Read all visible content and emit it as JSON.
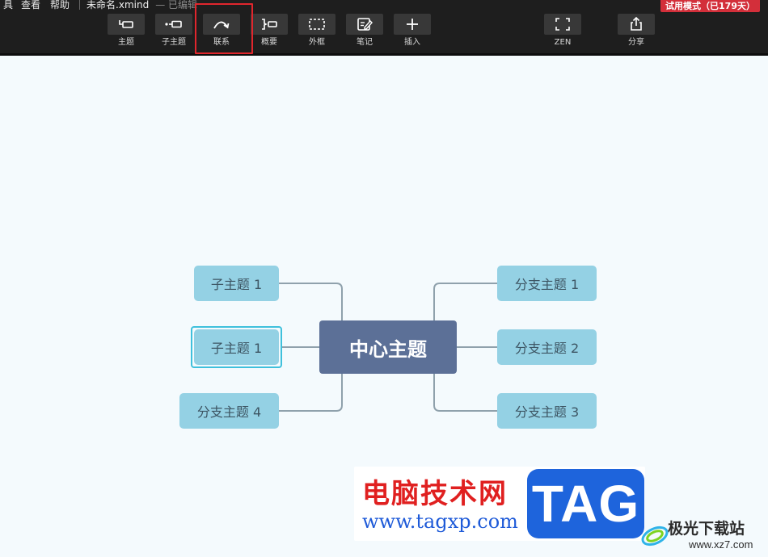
{
  "menu": {
    "items": [
      "具",
      "查看",
      "帮助"
    ],
    "file_name": "未命名.xmind",
    "file_status": "— 已编辑"
  },
  "trial_badge": "试用模式（已179天）",
  "toolbar": {
    "tools": [
      {
        "label": "主题",
        "icon": "topic-icon"
      },
      {
        "label": "子主题",
        "icon": "subtopic-icon"
      },
      {
        "label": "联系",
        "icon": "relationship-icon"
      },
      {
        "label": "概要",
        "icon": "summary-icon"
      },
      {
        "label": "外框",
        "icon": "boundary-icon"
      },
      {
        "label": "笔记",
        "icon": "notes-icon"
      },
      {
        "label": "插入",
        "icon": "plus-icon"
      },
      {
        "label": "ZEN",
        "icon": "zen-fullscreen-icon"
      },
      {
        "label": "分享",
        "icon": "share-icon"
      }
    ]
  },
  "mindmap": {
    "center": "中心主题",
    "left": [
      "子主题 1",
      "子主题 1",
      "分支主题 4"
    ],
    "right": [
      "分支主题 1",
      "分支主题 2",
      "分支主题 3"
    ]
  },
  "watermark": {
    "site_cn": "电脑技术网",
    "site_url": "www.tagxp.com",
    "tag": "TAG",
    "logo_cn": "极光下载站",
    "logo_url": "www.xz7.com"
  },
  "colors": {
    "toolbar_bg": "#1e1e1e",
    "canvas_bg": "#f4fafd",
    "center_node": "#5c7097",
    "branch_node": "#94d1e4",
    "highlight": "#e0262d",
    "selection": "#3fc0dc"
  }
}
